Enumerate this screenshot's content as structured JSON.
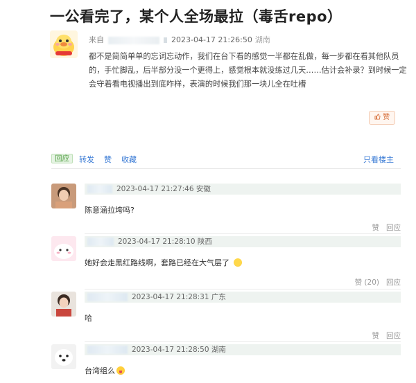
{
  "post": {
    "title": "一公看完了，某个人全场最拉（毒舌repo）",
    "from_label": "来自",
    "time": "2023-04-17 21:26:50",
    "location": "湖南",
    "content": "都不是简简单单的忘词忘动作，我们在台下看的感觉一半都在乱做，每一步都在看其他队员的，手忙脚乱，后半部分没一个更得上，感觉根本就没练过几天……估计会补录？到时候一定会守着看电视播出到底咋样，表演的时候我们那一块儿全在吐槽",
    "like_label": "赞"
  },
  "actions": {
    "reply": "回应",
    "forward": "转发",
    "like": "赞",
    "collect": "收藏",
    "only_owner": "只看楼主"
  },
  "comments": [
    {
      "time": "2023-04-17 21:27:46",
      "location": "安徽",
      "text": "陈意涵拉垮吗?",
      "like": "赞",
      "reply": "回应"
    },
    {
      "time": "2023-04-17 21:28:10",
      "location": "陕西",
      "text": "她好会走黑红路线啊，套路已经在大气层了",
      "like": "赞 (20)",
      "reply": "回应"
    },
    {
      "time": "2023-04-17 21:28:31",
      "location": "广东",
      "text": "哈",
      "like": "赞",
      "reply": "回应"
    },
    {
      "time": "2023-04-17 21:28:50",
      "location": "湖南",
      "text": "台湾组么",
      "like": "",
      "reply": ""
    }
  ],
  "colors": {
    "link": "#3a7bd5",
    "reply_tag_bg": "#e6f4e4",
    "like_btn": "#d56a34",
    "comment_head_bg": "#eef3f0"
  },
  "icons": [
    "duck-avatar-icon",
    "thumb-up-icon",
    "laugh-emoji-icon",
    "tongue-emoji-icon"
  ]
}
